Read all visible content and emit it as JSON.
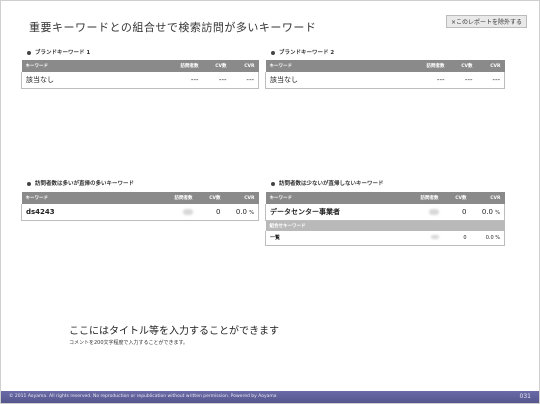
{
  "header": {
    "title": "重要キーワードとの組合せで検索訪問が多いキーワード",
    "exclude_button": "×このレポートを除外する"
  },
  "brand1": {
    "label": "ブランドキーワード 1",
    "columns": [
      "キーワード",
      "訪問者数",
      "CV数",
      "CVR"
    ],
    "row": {
      "keyword": "該当なし",
      "visitors": "---",
      "cv": "---",
      "cvr": "---"
    }
  },
  "brand2": {
    "label": "ブランドキーワード 2",
    "columns": [
      "キーワード",
      "訪問者数",
      "CV数",
      "CVR"
    ],
    "row": {
      "keyword": "該当なし",
      "visitors": "---",
      "cv": "---",
      "cvr": "---"
    }
  },
  "high_visit": {
    "label": "訪問者数は多いが直帰の多いキーワード",
    "columns": [
      "キーワード",
      "訪問者数",
      "CV数",
      "CVR"
    ],
    "row": {
      "keyword": "ds4243",
      "cv": "0",
      "cvr": "0.0",
      "unit": "%"
    }
  },
  "low_visit": {
    "label": "訪問者数は少ないが直帰しないキーワード",
    "columns": [
      "キーワード",
      "訪問者数",
      "CV数",
      "CVR"
    ],
    "row": {
      "keyword": "データセンター事業者",
      "cv": "0",
      "cvr": "0.0",
      "unit": "%"
    },
    "combo_header": "組合せキーワード",
    "combo_row": {
      "keyword": "一覧",
      "cv": "0",
      "cvr": "0.0 %"
    }
  },
  "footer": {
    "title": "ここにはタイトル等を入力することができます",
    "comment": "コメントを200文字程度で入力することができます。",
    "copyright": "© 2011 Aoyama. All rights reserved. No reproduction or republication without written permission. Powered by Aoyama",
    "page_number": "031"
  },
  "colors": {
    "table_header": "#8a8a8a",
    "bottom_bar": "#5a5a9a"
  }
}
